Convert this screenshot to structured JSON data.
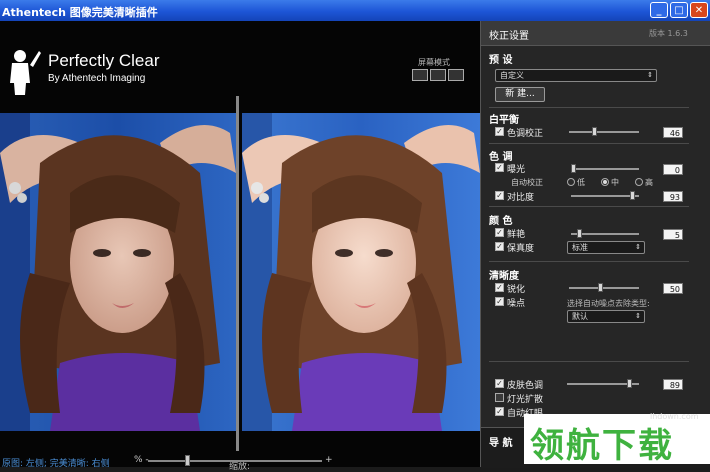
{
  "window": {
    "title": "Athentech 图像完美清晰插件",
    "controls": {
      "minimize": "_",
      "maximize": "□",
      "close": "✕"
    }
  },
  "brand": {
    "name": "Perfectly Clear",
    "sub": "By Athentech Imaging"
  },
  "view_mode": {
    "label": "屏幕模式",
    "buttons": [
      "view-single",
      "view-split",
      "view-side-by-side"
    ]
  },
  "viewer": {
    "zoom_label": "缩放:",
    "status": "原图: 左侧; 完美清晰: 右侧",
    "zoom_minus": "% -",
    "zoom_plus": "+",
    "zoom_fraction": 0.22
  },
  "panel": {
    "title": "校正设置",
    "version": "版本 1.6.3",
    "presets": {
      "title": "预 设",
      "selected": "自定义",
      "new_button": "新 建..."
    },
    "white_balance": {
      "title": "白平衡",
      "tint_label": "色调校正",
      "tint_checked": true,
      "tint_value": "46",
      "tint_fraction": 0.35
    },
    "tone": {
      "title": "色 调",
      "exposure_label": "曝光",
      "exposure_checked": true,
      "exposure_value": "0",
      "exposure_fraction": 0.0,
      "auto_correct_label": "自动校正",
      "radio_low": "低",
      "radio_mid": "中",
      "radio_high": "高",
      "radio_selected": "中",
      "contrast_label": "对比度",
      "contrast_checked": true,
      "contrast_value": "93",
      "contrast_fraction": 0.93
    },
    "color": {
      "title": "颜 色",
      "vibrancy_label": "鲜艳",
      "vibrancy_checked": true,
      "vibrancy_value": "5",
      "vibrancy_fraction": 0.1,
      "fidelity_label": "保真度",
      "fidelity_checked": true,
      "fidelity_selected": "标准"
    },
    "sharpness": {
      "title": "清晰度",
      "sharpen_label": "锐化",
      "sharpen_checked": true,
      "sharpen_value": "50",
      "sharpen_fraction": 0.45,
      "noise_label": "噪点",
      "noise_checked": true,
      "noise_hint": "选择自动噪点去除类型:",
      "noise_selected": "默认"
    },
    "extras": {
      "skin_tone_label": "皮肤色调",
      "skin_tone_checked": true,
      "skin_tone_value": "89",
      "skin_tone_fraction": 0.89,
      "light_diffusion_label": "灯光扩散",
      "light_diffusion_checked": false,
      "red_eye_label": "自动红眼",
      "red_eye_checked": true
    },
    "navigation": {
      "title": "导 航"
    }
  },
  "watermark": {
    "host": "lhdown.com",
    "text": "领航下载"
  },
  "colors": {
    "titlebar": "#1d55d6",
    "panel_bg": "#262626",
    "status_link": "#4b8fd6",
    "watermark_green": "#3fb23f"
  },
  "icons": {
    "logo": "athentech-figure-icon",
    "select_arrow": "chevron-updown-icon"
  }
}
